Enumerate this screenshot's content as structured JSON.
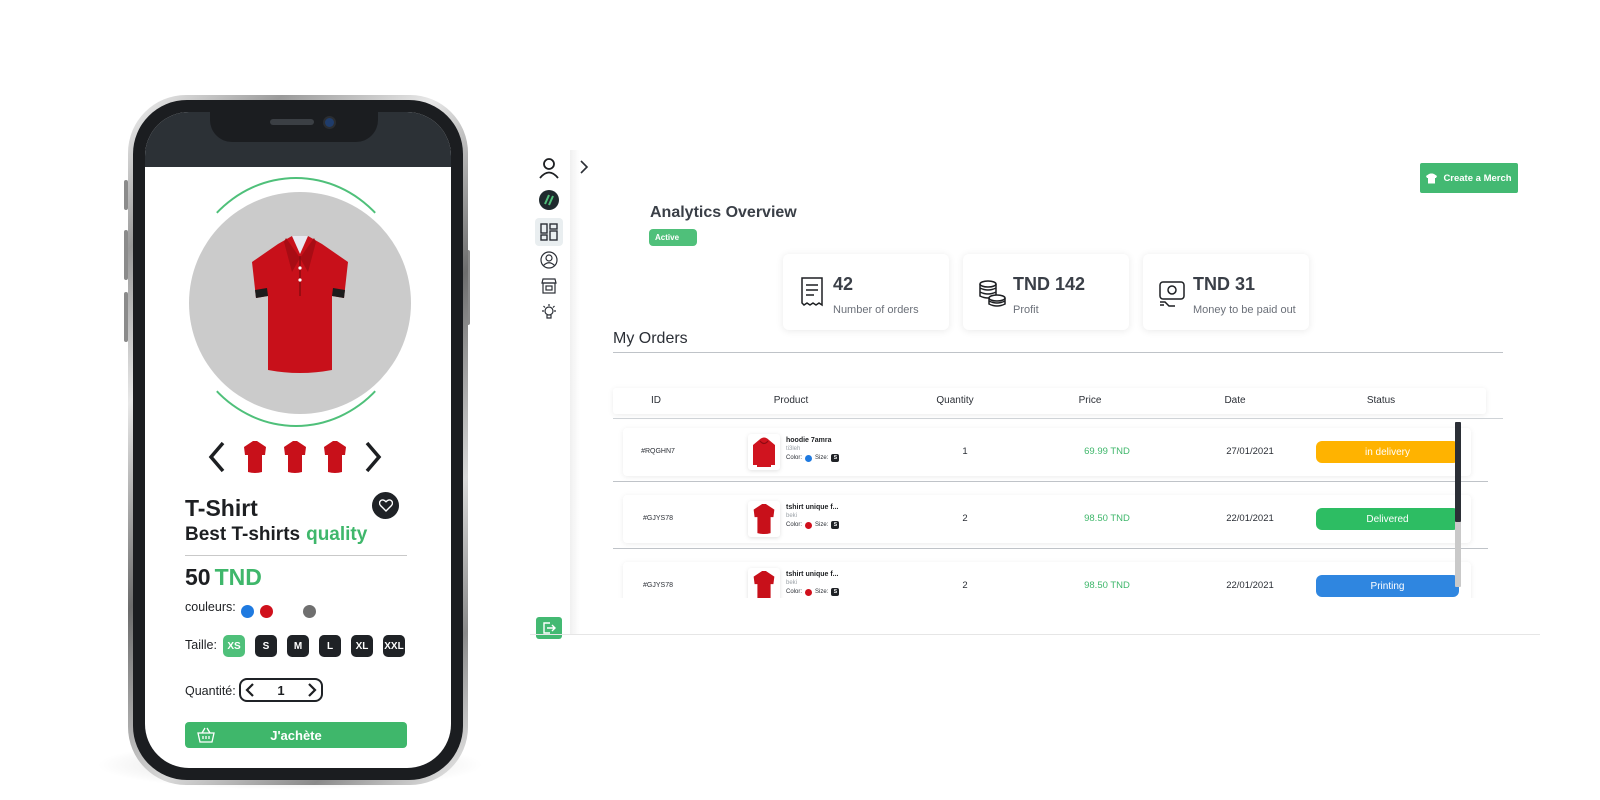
{
  "phone": {
    "product_name": "T-Shirt",
    "tagline_main": "Best T-shirts",
    "tagline_accent": "quality",
    "price_amount": "50",
    "price_currency": "TND",
    "colors_label": "couleurs:",
    "colors": [
      "#1f7ae0",
      "#d0101c",
      "#6f6f6f"
    ],
    "size_label": "Taille:",
    "sizes": [
      "XS",
      "S",
      "M",
      "L",
      "XL",
      "XXL"
    ],
    "selected_size": "XS",
    "quantity_label": "Quantité:",
    "quantity_value": "1",
    "buy_label": "J'achète",
    "accent_color": "#3fb76b"
  },
  "dashboard": {
    "create_button_label": "Create a Merch",
    "overview_title": "Analytics Overview",
    "status_badge": "Active",
    "stats": [
      {
        "icon": "receipt-icon",
        "value": "42",
        "label": "Number of orders"
      },
      {
        "icon": "coins-icon",
        "value": "TND 142",
        "label": "Profit"
      },
      {
        "icon": "payout-icon",
        "value": "TND 31",
        "label": "Money to be paid out"
      }
    ],
    "orders_title": "My Orders",
    "columns": [
      "ID",
      "Product",
      "Quantity",
      "Price",
      "Date",
      "Status"
    ],
    "orders": [
      {
        "id": "#RQGHN7",
        "product": "hoodie 7amra",
        "seller": "ti3leh",
        "color": "#1f7ae0",
        "size": "S",
        "quantity": "1",
        "price": "69.99 TND",
        "date": "27/01/2021",
        "status": "in delivery",
        "status_color": "#ffb300"
      },
      {
        "id": "#GJYS78",
        "product": "tshirt unique f...",
        "seller": "beki",
        "color": "#d0101c",
        "size": "S",
        "quantity": "2",
        "price": "98.50 TND",
        "date": "22/01/2021",
        "status": "Delivered",
        "status_color": "#2dbd63"
      },
      {
        "id": "#GJYS78",
        "product": "tshirt unique f...",
        "seller": "beki",
        "color": "#d0101c",
        "size": "S",
        "quantity": "2",
        "price": "98.50 TND",
        "date": "22/01/2021",
        "status": "Printing",
        "status_color": "#2f86e0"
      }
    ],
    "color_label": "Color:",
    "size_label": "Size:"
  }
}
